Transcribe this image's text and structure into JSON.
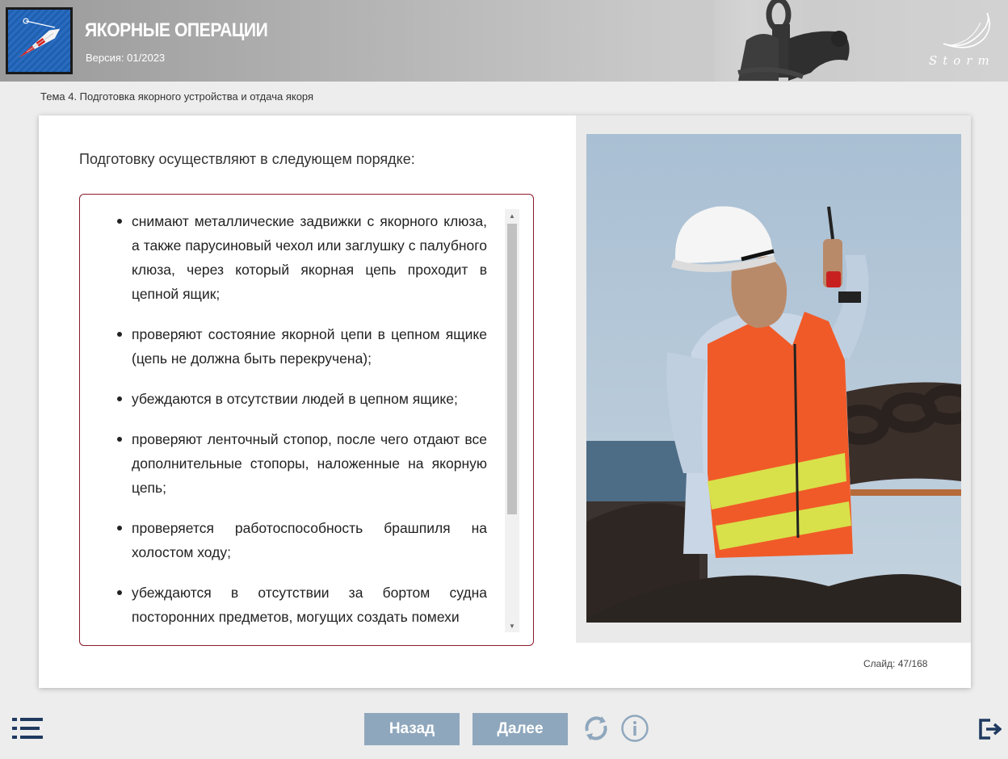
{
  "header": {
    "title": "ЯКОРНЫЕ ОПЕРАЦИИ",
    "version": "Версия: 01/2023",
    "brand": "Storm"
  },
  "breadcrumb": "Тема 4. Подготовка якорного устройства и отдача якоря",
  "content": {
    "intro": "Подготовку осуществляют в следующем порядке:",
    "items": [
      "снимают металлические задвижки с якорного клюза, а также парусиновый чехол или заглушку с палубного клюза, через который якорная цепь проходит в цепной ящик;",
      "проверяют состояние якорной цепи в цепном ящике (цепь не должна быть перекручена);",
      "убеждаются в отсутствии людей в цепном ящике;",
      "проверяют ленточный стопор, после чего отдают все дополнительные стопоры, наложенные на якорную цепь;",
      "проверяется работоспособность брашпиля на холостом ходу;",
      "убеждаются в отсутствии за бортом судна посторонних предметов, могущих создать помехи"
    ]
  },
  "slide": {
    "label": "Слайд:",
    "current": "47",
    "separator": "/",
    "total": "168"
  },
  "footer": {
    "back_label": "Назад",
    "next_label": "Далее"
  },
  "icons": {
    "menu": "list-menu-icon",
    "refresh": "refresh-icon",
    "info": "info-icon",
    "exit": "exit-icon",
    "scroll_up": "triangle-up-icon",
    "scroll_down": "triangle-down-icon"
  },
  "colors": {
    "nav_button": "#8fa7bd",
    "list_border": "#8b1a2b",
    "icon_dark": "#1f3a5f",
    "icon_light": "#8fa7bd",
    "header_bg": "#b3b3b3"
  }
}
